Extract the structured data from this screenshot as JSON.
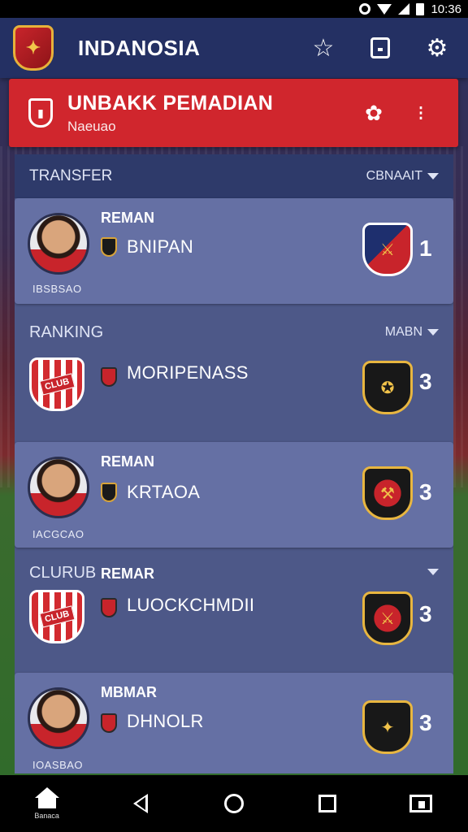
{
  "status_bar": {
    "time": "10:36"
  },
  "app_bar": {
    "title": "INDANOSIA"
  },
  "banner": {
    "title": "UNBAKK PEMADIAN",
    "subtitle": "Naeuao"
  },
  "sections": {
    "transfer": {
      "label": "TRANSFER",
      "dropdown": "CBNAAIT"
    },
    "ranking": {
      "label": "RANKING",
      "dropdown": "MABN"
    },
    "club": {
      "label": "CLURUB"
    }
  },
  "rows": [
    {
      "kicker": "REMAN",
      "name": "BNIPAN",
      "caption": "IBSBSAO",
      "rank": "1"
    },
    {
      "kicker": "",
      "name": "MORIPENASS",
      "caption": "",
      "rank": "3"
    },
    {
      "kicker": "REMAN",
      "name": "KRTAOA",
      "caption": "IACGCAO",
      "rank": "3"
    },
    {
      "kicker": "REMAR",
      "name": "LUOCKCHMDII",
      "caption": "",
      "rank": "3"
    },
    {
      "kicker": "MBMAR",
      "name": "DHNOLR",
      "caption": "IOASBAO",
      "rank": "3"
    }
  ],
  "nav": {
    "home_label": "Banaca"
  },
  "colors": {
    "app_bar": "#243063",
    "banner": "#d0262d",
    "panel": "#4d5888",
    "row": "#6570a4"
  }
}
